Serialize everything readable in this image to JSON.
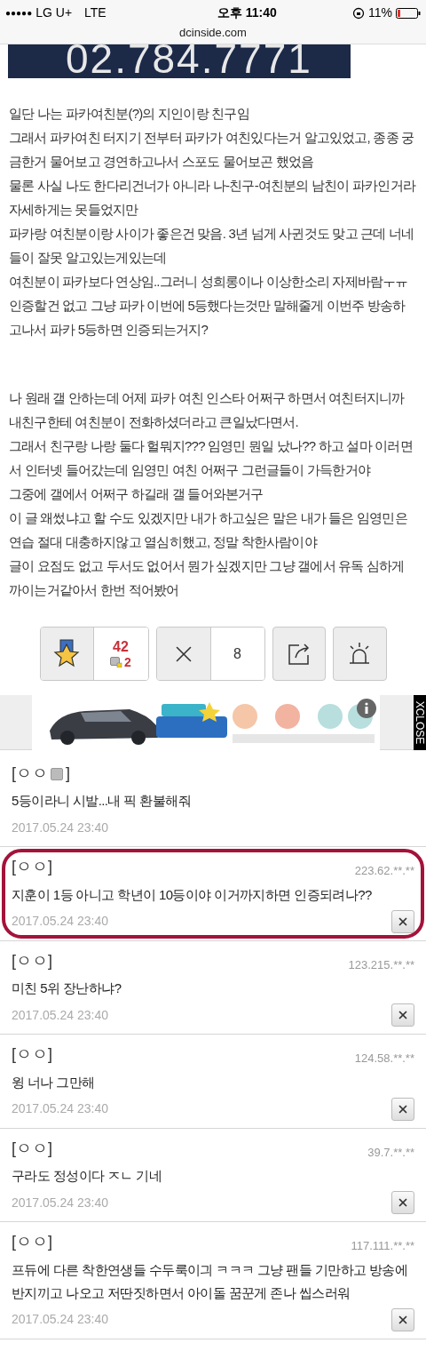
{
  "status_bar": {
    "signal": "●●●●●",
    "carrier": "LG U+",
    "network": "LTE",
    "time": "오후 11:40",
    "battery": "11%"
  },
  "address_bar": {
    "url": "dcinside.com"
  },
  "top_banner": {
    "text": "02.784.7771"
  },
  "post": {
    "paragraphs": [
      [
        "일단 나는 파카여친분(?)의 지인이랑 친구임",
        "그래서 파카여친 터지기 전부터 파카가 여친있다는거 알고있었고, 종종 궁금한거 물어보고 경연하고나서 스포도 물어보곤 했었음",
        "물론 사실 나도 한다리건너가 아니라 나-친구-여친분의 남친이 파카인거라 자세하게는 못들었지만",
        "파카랑 여친분이랑 사이가 좋은건 맞음. 3년 넘게 사귄것도 맞고 근데 너네들이 잘못 알고있는게있는데",
        "여친분이 파카보다 연상임..그러니 성희롱이나 이상한소리 자제바람ㅜㅠ",
        "인증할건 없고 그냥 파카 이번에 5등했다는것만 말해줄게 이번주 방송하고나서 파카 5등하면 인증되는거지?"
      ],
      [
        "나 원래 갤 안하는데 어제 파카 여친 인스타 어쩌구 하면서 여친터지니까",
        "내친구한테 여친분이 전화하셨더라고 큰일났다면서.",
        "그래서 친구랑 나랑 둘다 헐뭐지??? 임영민 뭔일 났나?? 하고 설마 이러면서 인터넷 들어갔는데 임영민 여친 어쩌구 그런글들이 가득한거야",
        "그중에 갤에서 어쩌구 하길래 갤 들어와본거구",
        "이 글 왜썼냐고 할 수도 있겠지만 내가 하고싶은 말은 내가 들은 임영민은 연습 절대 대충하지않고 열심히했고, 정말 착한사람이야",
        "글이 요점도 없고 두서도 없어서 뭔가 싶겠지만 그냥 갤에서 유독 심하게 까이는거같아서 한번 적어봤어"
      ]
    ]
  },
  "actions": {
    "recommend_count": "42",
    "fixed_recommend_count": "2",
    "downvote_count": "8"
  },
  "ad": {
    "kind": "picture",
    "close_label": "XCLOSE"
  },
  "comments": [
    {
      "name": "[ㅇㅇ",
      "fixed_nick": true,
      "name_end": "]",
      "text": "5등이라니 시발...내 픽 환불해줘",
      "date": "2017.05.24 23:40",
      "deletable": false,
      "highlighted": false
    },
    {
      "name": "[ㅇㅇ",
      "fixed_nick": false,
      "name_end": "]",
      "ip": "223.62.**.**",
      "text": "지훈이 1등 아니고 학년이 10등이야 이거까지하면 인증되려나??",
      "date": "2017.05.24 23:40",
      "deletable": true,
      "highlighted": true
    },
    {
      "name": "[ㅇㅇ",
      "fixed_nick": false,
      "name_end": "]",
      "ip": "123.215.**.**",
      "text": "미친 5위 장난하냐?",
      "date": "2017.05.24 23:40",
      "deletable": true,
      "highlighted": false
    },
    {
      "name": "[ㅇㅇ",
      "fixed_nick": false,
      "name_end": "]",
      "ip": "124.58.**.**",
      "text": "윙 너나 그만해",
      "date": "2017.05.24 23:40",
      "deletable": true,
      "highlighted": false
    },
    {
      "name": "[ㅇㅇ",
      "fixed_nick": false,
      "name_end": "]",
      "ip": "39.7.**.**",
      "text": "구라도 정성이다 ㅈㄴ 기네",
      "date": "2017.05.24 23:40",
      "deletable": true,
      "highlighted": false
    },
    {
      "name": "[ㅇㅇ",
      "fixed_nick": false,
      "name_end": "]",
      "ip": "117.111.**.**",
      "text": "프듀에 다른 착한연생들 수두룩이긔 ㅋㅋㅋ 그냥 팬들 기만하고 방송에 반지끼고 나오고 저딴짓하면서 아이돌 꿈꾼게 존나 씹스러워",
      "date": "2017.05.24 23:40",
      "deletable": true,
      "highlighted": false
    }
  ]
}
